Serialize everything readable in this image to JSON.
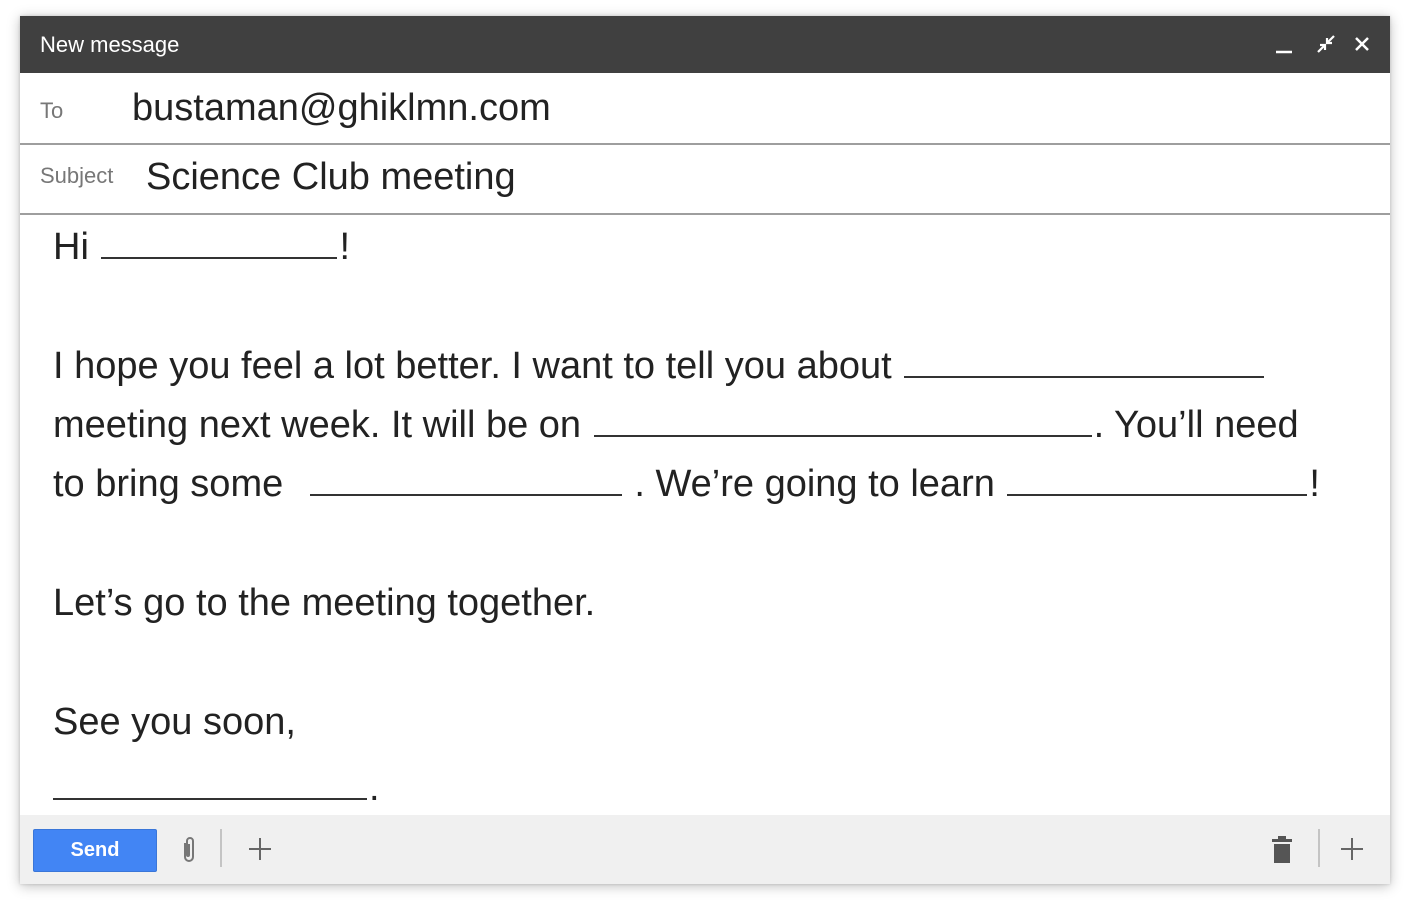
{
  "window": {
    "title": "New message"
  },
  "fields": {
    "to_label": "To",
    "to_value": "bustaman@ghiklmn.com",
    "subject_label": "Subject",
    "subject_value": "Science Club meeting"
  },
  "body": {
    "greeting_prefix": "Hi",
    "greeting_suffix": "!",
    "line1": "I hope you feel a lot better. I want to tell you about",
    "line2_prefix": "meeting next week. It will be on",
    "line2_suffix": ". You’ll need",
    "line3_prefix": "to bring some",
    "line3_middle": ". We’re going to learn",
    "line3_suffix": "!",
    "line4": "Let’s go to the meeting together.",
    "line5": "See you soon,",
    "signature_suffix": "."
  },
  "footer": {
    "send_label": "Send"
  },
  "icons": {
    "minimize": "minimize-icon",
    "popout": "popout-icon",
    "close": "close-icon",
    "attach": "paperclip-icon",
    "more": "plus-icon",
    "trash": "trash-icon"
  },
  "colors": {
    "titlebar": "#404040",
    "send_button": "#4285f4",
    "footer": "#f0f0f0"
  }
}
